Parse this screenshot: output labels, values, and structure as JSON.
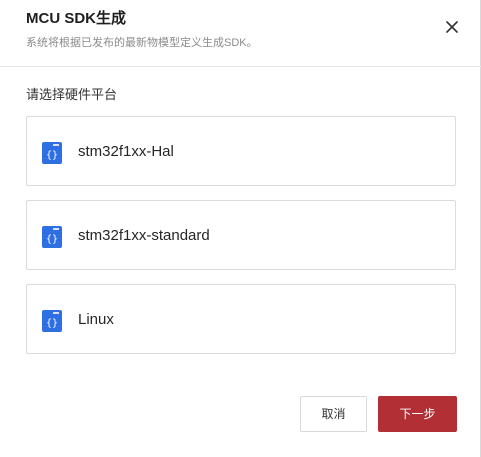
{
  "dialog": {
    "title": "MCU SDK生成",
    "subtitle": "系统将根据已发布的最新物模型定义生成SDK。"
  },
  "section": {
    "label": "请选择硬件平台"
  },
  "options": [
    {
      "label": "stm32f1xx-Hal",
      "icon": "code-braces-icon"
    },
    {
      "label": "stm32f1xx-standard",
      "icon": "code-braces-icon"
    },
    {
      "label": "Linux",
      "icon": "code-braces-icon"
    }
  ],
  "footer": {
    "cancel_label": "取消",
    "next_label": "下一步"
  },
  "colors": {
    "primary": "#b22f35",
    "icon_blue": "#2f6fe4"
  }
}
